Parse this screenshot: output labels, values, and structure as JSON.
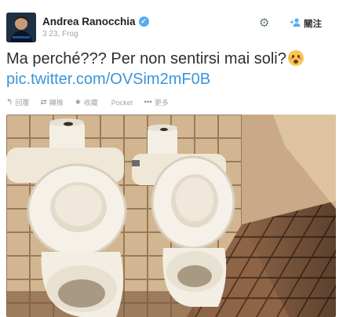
{
  "user": {
    "name": "Andrea Ranocchia",
    "verified_icon": "verified-badge-icon",
    "meta": "3 23, Frog"
  },
  "header": {
    "settings_icon": "gear-icon",
    "follow_icon": "follow-user-icon",
    "follow_label": "關注"
  },
  "tweet": {
    "text": "Ma perché??? Per non sentirsi mai soli?",
    "emoji": "flushed-face-emoji",
    "link": "pic.twitter.com/OVSim2mF0B"
  },
  "actions": [
    {
      "icon": "reply-icon",
      "glyph": "↰",
      "label": "回覆"
    },
    {
      "icon": "retweet-icon",
      "glyph": "⇄",
      "label": "轉推"
    },
    {
      "icon": "star-icon",
      "glyph": "★",
      "label": "收藏"
    },
    {
      "icon": "pocket-icon",
      "glyph": "",
      "label": "Pocket"
    },
    {
      "icon": "more-icon",
      "glyph": "•••",
      "label": "更多"
    }
  ],
  "colors": {
    "link": "#3b94d9",
    "verified": "#55acee",
    "tile": "#d9c3a4",
    "grout": "#8a6a4a",
    "porcelain": "#f3efe6"
  }
}
